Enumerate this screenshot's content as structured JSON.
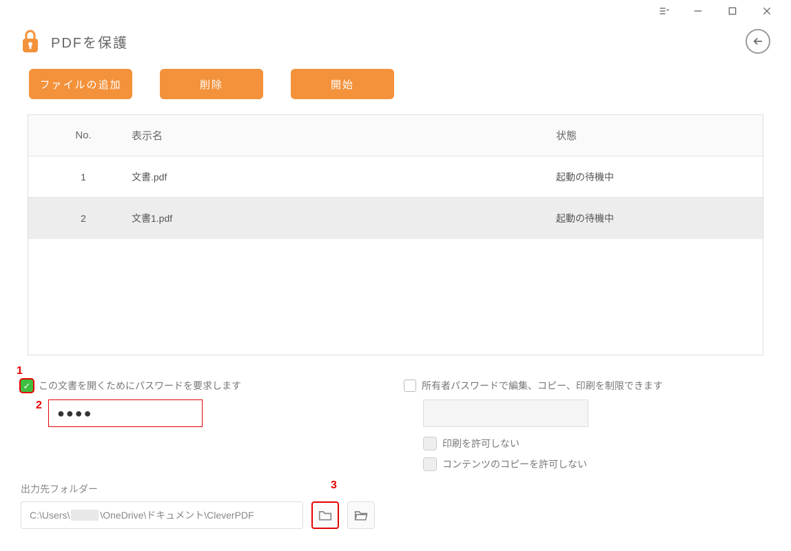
{
  "header": {
    "title": "PDFを保護"
  },
  "actions": {
    "add_file": "ファイルの追加",
    "delete": "削除",
    "start": "開始"
  },
  "table": {
    "headers": {
      "no": "No.",
      "name": "表示名",
      "status": "状態"
    },
    "rows": [
      {
        "no": "1",
        "name": "文書.pdf",
        "status": "起動の待機中"
      },
      {
        "no": "2",
        "name": "文書1.pdf",
        "status": "起動の待機中"
      }
    ]
  },
  "options": {
    "require_password_label": "この文書を開くためにパスワードを要求します",
    "password_value": "●●●●",
    "owner_password_label": "所有者パスワードで編集、コピー、印刷を制限できます",
    "disallow_print": "印刷を許可しない",
    "disallow_copy": "コンテンツのコピーを許可しない"
  },
  "output": {
    "label": "出力先フォルダー",
    "path_prefix": "C:\\Users\\",
    "path_suffix": "\\OneDrive\\ドキュメント\\CleverPDF"
  },
  "markers": {
    "m1": "1",
    "m2": "2",
    "m3": "3"
  }
}
